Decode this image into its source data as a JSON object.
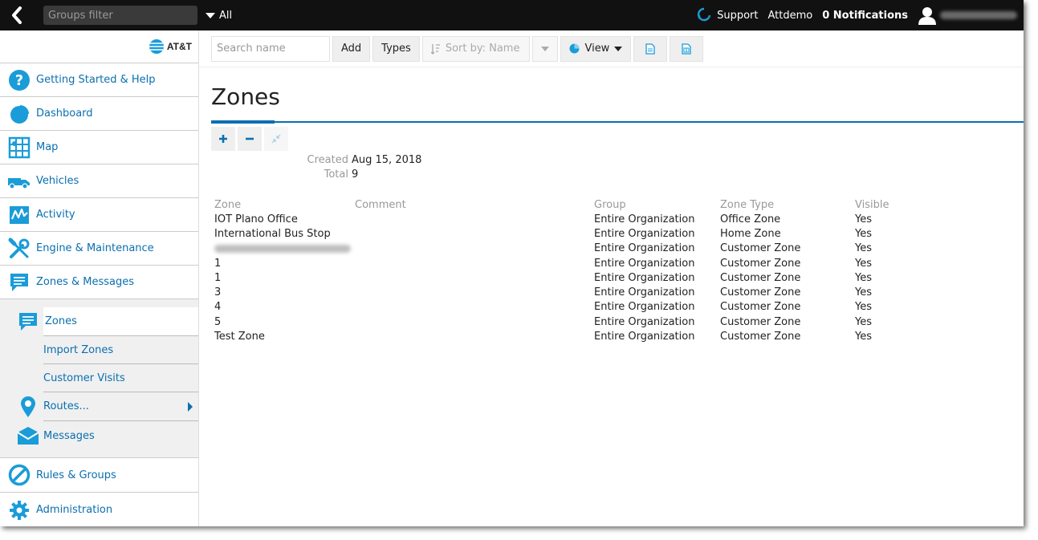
{
  "topbar": {
    "groups_filter_placeholder": "Groups filter",
    "all_label": "All",
    "support_label": "Support",
    "user_name": "Attdemo",
    "notifications_label": "0 Notifications"
  },
  "brand": {
    "logo_text": "AT&T"
  },
  "sidebar": {
    "items": [
      {
        "label": "Getting Started & Help",
        "icon": "help-icon"
      },
      {
        "label": "Dashboard",
        "icon": "dashboard-icon"
      },
      {
        "label": "Map",
        "icon": "map-icon"
      },
      {
        "label": "Vehicles",
        "icon": "vehicles-icon"
      },
      {
        "label": "Activity",
        "icon": "activity-icon"
      },
      {
        "label": "Engine & Maintenance",
        "icon": "engine-icon"
      },
      {
        "label": "Zones & Messages",
        "icon": "zones-messages-icon"
      }
    ],
    "sub_items": [
      {
        "label": "Zones",
        "icon": "zones-icon",
        "active": true
      },
      {
        "label": "Import Zones"
      },
      {
        "label": "Customer Visits"
      },
      {
        "label": "Routes...",
        "icon": "routes-icon"
      },
      {
        "label": "Messages",
        "icon": "messages-icon"
      }
    ],
    "bottom_items": [
      {
        "label": "Rules & Groups",
        "icon": "rules-icon"
      },
      {
        "label": "Administration",
        "icon": "gear-icon"
      }
    ]
  },
  "toolbar": {
    "search_placeholder": "Search name",
    "add_label": "Add",
    "types_label": "Types",
    "sort_label": "Sort by: Name",
    "view_label": "View"
  },
  "page": {
    "title": "Zones",
    "created_label": "Created",
    "created_value": "Aug 15, 2018",
    "total_label": "Total",
    "total_value": "9"
  },
  "table": {
    "headers": [
      "Zone",
      "Comment",
      "Group",
      "Zone Type",
      "Visible"
    ],
    "rows": [
      {
        "zone": "IOT Plano Office",
        "comment": "",
        "group": "Entire Organization",
        "type": "Office Zone",
        "visible": "Yes"
      },
      {
        "zone": "International Bus Stop",
        "comment": "",
        "group": "Entire Organization",
        "type": "Home Zone",
        "visible": "Yes"
      },
      {
        "zone": "",
        "comment": "",
        "group": "Entire Organization",
        "type": "Customer Zone",
        "visible": "Yes",
        "redacted": true
      },
      {
        "zone": "1",
        "comment": "",
        "group": "Entire Organization",
        "type": "Customer Zone",
        "visible": "Yes"
      },
      {
        "zone": "1",
        "comment": "",
        "group": "Entire Organization",
        "type": "Customer Zone",
        "visible": "Yes"
      },
      {
        "zone": "3",
        "comment": "",
        "group": "Entire Organization",
        "type": "Customer Zone",
        "visible": "Yes"
      },
      {
        "zone": "4",
        "comment": "",
        "group": "Entire Organization",
        "type": "Customer Zone",
        "visible": "Yes"
      },
      {
        "zone": "5",
        "comment": "",
        "group": "Entire Organization",
        "type": "Customer Zone",
        "visible": "Yes"
      },
      {
        "zone": "Test Zone",
        "comment": "",
        "group": "Entire Organization",
        "type": "Customer Zone",
        "visible": "Yes"
      }
    ]
  },
  "colors": {
    "accent": "#0a6fb0",
    "icon_blue": "#1a9cd8",
    "topbar_bg": "#111111"
  }
}
